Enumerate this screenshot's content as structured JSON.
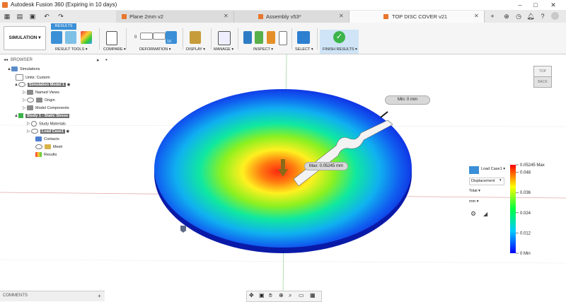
{
  "window": {
    "title": "Autodesk Fusion 360 (Expiring in 10 days)"
  },
  "tabs": [
    {
      "label": "Plane 2mm v2",
      "active": false
    },
    {
      "label": "Assembly v53*",
      "active": false
    },
    {
      "label": "TOP DISC COVER v21",
      "active": true
    }
  ],
  "ribbon": {
    "workspace": "SIMULATION ▾",
    "active_tab": "RESULTS",
    "groups": [
      {
        "label": "RESULT TOOLS ▾"
      },
      {
        "label": "COMPARE ▾"
      },
      {
        "label": "DEFORMATION ▾"
      },
      {
        "label": "DISPLAY ▾"
      },
      {
        "label": "MANAGE ▾"
      },
      {
        "label": "INSPECT ▾"
      },
      {
        "label": "SELECT ▾"
      },
      {
        "label": "FINISH RESULTS ▾"
      }
    ],
    "deformation_value": "0",
    "deformation_scale": "1X"
  },
  "browser": {
    "header": "BROWSER",
    "items": [
      {
        "label": "Simulations"
      },
      {
        "label": "Units: Custom"
      },
      {
        "label": "Simulation Model 1"
      },
      {
        "label": "Named Views"
      },
      {
        "label": "Origin"
      },
      {
        "label": "Model Components"
      },
      {
        "label": "Study 1 - Static Stress"
      },
      {
        "label": "Study Materials"
      },
      {
        "label": "Load Case1"
      },
      {
        "label": "Contacts"
      },
      {
        "label": "Mesh"
      },
      {
        "label": "Results"
      }
    ]
  },
  "viewport": {
    "min_label": "Min: 0 mm",
    "max_label": "Max: 0.05245 mm",
    "viewcube_top": "TOP",
    "viewcube_back": "BACK"
  },
  "results_panel": {
    "load_case": "Load Case1 ▾",
    "result_type": "Displacement",
    "component": "Total ▾",
    "unit": "mm ▾"
  },
  "legend": {
    "ticks": [
      {
        "label": "0.05245 Max",
        "value": 0.05245
      },
      {
        "label": "0.048",
        "value": 0.048
      },
      {
        "label": "0.036",
        "value": 0.036
      },
      {
        "label": "0.024",
        "value": 0.024
      },
      {
        "label": "0.012",
        "value": 0.012
      },
      {
        "label": "0 Min",
        "value": 0
      }
    ]
  },
  "comments": {
    "label": "COMMENTS"
  },
  "colors": {
    "accent": "#3a8fd6",
    "orange": "#e8762d",
    "finish_green": "#3cb44a"
  }
}
